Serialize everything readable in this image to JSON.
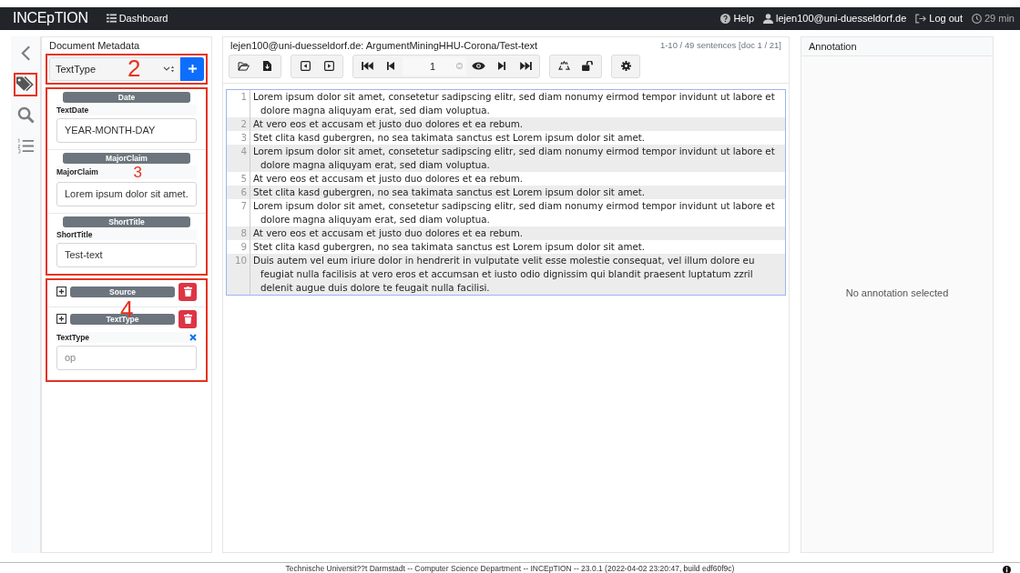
{
  "navbar": {
    "brand": "INCEpTION",
    "dashboard": "Dashboard",
    "help": "Help",
    "user": "lejen100@uni-duesseldorf.de",
    "logout": "Log out",
    "timer": "29 min"
  },
  "sidebar": {
    "items": [
      {
        "kind": "collapse",
        "selected": false,
        "callout": false
      },
      {
        "kind": "tags",
        "selected": true,
        "callout": true
      },
      {
        "kind": "search",
        "selected": false,
        "callout": false
      },
      {
        "kind": "list",
        "selected": false,
        "callout": false
      }
    ]
  },
  "metadata": {
    "title": "Document Metadata",
    "layer_select": "TextType",
    "select_callout": "2",
    "groups": [
      {
        "callout": "3",
        "entries": [
          {
            "kind": "field",
            "header": "Date",
            "label": "TextDate",
            "value": "YEAR-MONTH-DAY"
          },
          {
            "kind": "field",
            "header": "MajorClaim",
            "label": "MajorClaim",
            "value": "Lorem ipsum dolor sit amet."
          },
          {
            "kind": "field",
            "header": "ShortTitle",
            "label": "ShortTitle",
            "value": "Test-text"
          }
        ]
      },
      {
        "callout": "4",
        "entries": [
          {
            "kind": "deletable",
            "header": "Source"
          },
          {
            "kind": "deletable",
            "header": "TextType",
            "label": "TextType",
            "placeholder": "op"
          }
        ]
      }
    ]
  },
  "document": {
    "title": "lejen100@uni-duesseldorf.de: ArgumentMiningHHU-Corona/Test-text",
    "range": "1-10 / 49 sentences [doc 1 / 21]",
    "page": "1",
    "sentences": [
      {
        "number": "1",
        "text": "Lorem ipsum dolor sit amet, consetetur sadipscing elitr, sed diam nonumy eirmod tempor invidunt ut labore et dolore magna aliquyam erat, sed diam voluptua."
      },
      {
        "number": "2",
        "text": "At vero eos et accusam et justo duo dolores et ea rebum."
      },
      {
        "number": "3",
        "text": "Stet clita kasd gubergren, no sea takimata sanctus est Lorem ipsum dolor sit amet."
      },
      {
        "number": "4",
        "text": "Lorem ipsum dolor sit amet, consetetur sadipscing elitr, sed diam nonumy eirmod tempor invidunt ut labore et dolore magna aliquyam erat, sed diam voluptua."
      },
      {
        "number": "5",
        "text": "At vero eos et accusam et justo duo dolores et ea rebum."
      },
      {
        "number": "6",
        "text": "Stet clita kasd gubergren, no sea takimata sanctus est Lorem ipsum dolor sit amet."
      },
      {
        "number": "7",
        "text": "Lorem ipsum dolor sit amet, consetetur sadipscing elitr, sed diam nonumy eirmod tempor invidunt ut labore et dolore magna aliquyam erat, sed diam voluptua."
      },
      {
        "number": "8",
        "text": "At vero eos et accusam et justo duo dolores et ea rebum."
      },
      {
        "number": "9",
        "text": "Stet clita kasd gubergren, no sea takimata sanctus est Lorem ipsum dolor sit amet."
      },
      {
        "number": "10",
        "text": "Duis autem vel eum iriure dolor in hendrerit in vulputate velit esse molestie consequat, vel illum dolore eu feugiat nulla facilisis at vero eros et accumsan et iusto odio dignissim qui blandit praesent luptatum zzril delenit augue duis dolore te feugait nulla facilisi."
      }
    ]
  },
  "annotation": {
    "title": "Annotation",
    "empty": "No annotation selected"
  },
  "footer": "Technische Universit??t Darmstadt -- Computer Science Department -- INCEpTION -- 23.0.1 (2022-04-02 23:20:47, build edf60f9c)"
}
